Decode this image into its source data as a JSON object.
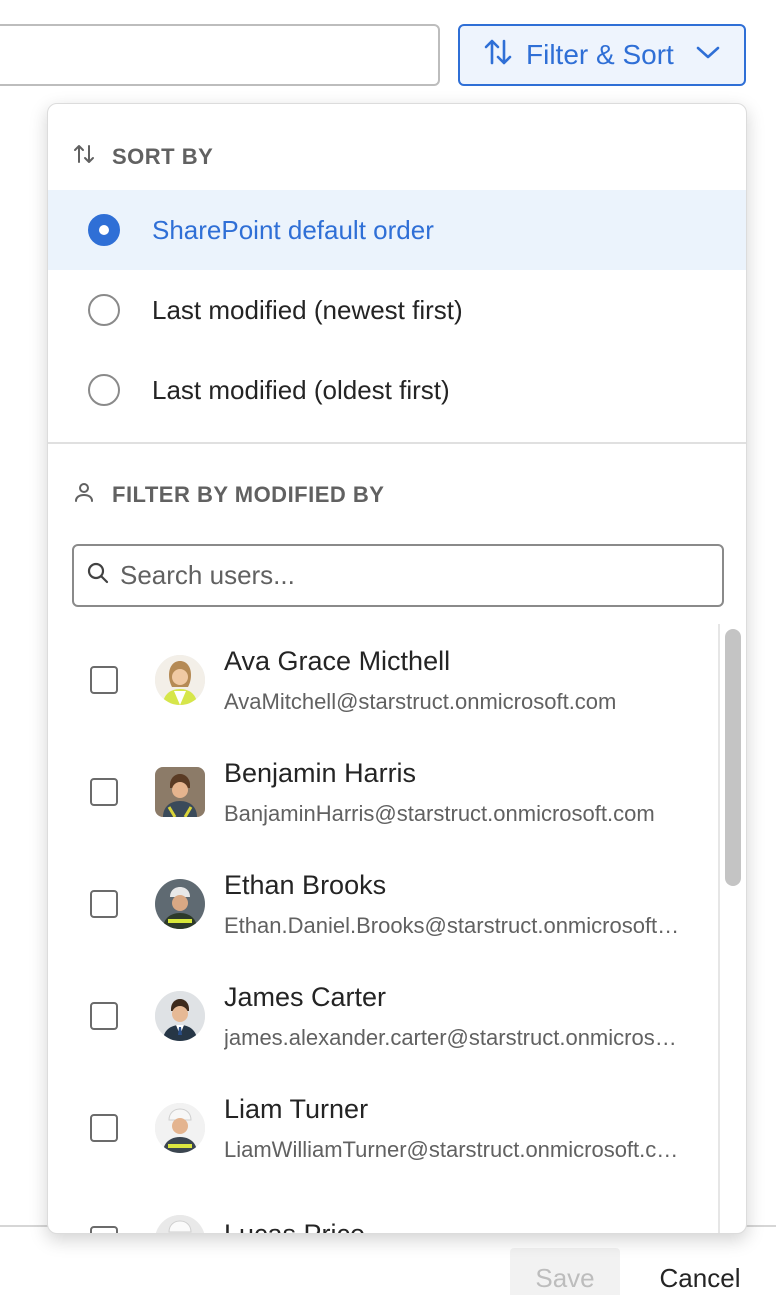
{
  "toolbar": {
    "filter_button_label": "Filter & Sort"
  },
  "dropdown": {
    "sort_heading": "SORT BY",
    "sort_options": [
      {
        "label": "SharePoint default order",
        "selected": true
      },
      {
        "label": "Last modified (newest first)",
        "selected": false
      },
      {
        "label": "Last modified (oldest first)",
        "selected": false
      }
    ],
    "filter_heading": "FILTER BY MODIFIED BY",
    "search_placeholder": "Search users...",
    "users": [
      {
        "name": "Ava Grace Micthell",
        "email": "AvaMitchell@starstruct.onmicrosoft.com",
        "checked": false
      },
      {
        "name": "Benjamin Harris",
        "email": "BanjaminHarris@starstruct.onmicrosoft.com",
        "checked": false
      },
      {
        "name": "Ethan Brooks",
        "email": "Ethan.Daniel.Brooks@starstruct.onmicrosoft.com",
        "checked": false
      },
      {
        "name": "James Carter",
        "email": "james.alexander.carter@starstruct.onmicrosoft.com",
        "checked": false
      },
      {
        "name": "Liam Turner",
        "email": "LiamWilliamTurner@starstruct.onmicrosoft.com",
        "checked": false
      },
      {
        "name": "Lucas Price",
        "email": "",
        "checked": false
      }
    ]
  },
  "footer": {
    "save_label": "Save",
    "cancel_label": "Cancel"
  },
  "colors": {
    "accent": "#2f6fd6",
    "selected_bg": "#ebf3fc"
  }
}
